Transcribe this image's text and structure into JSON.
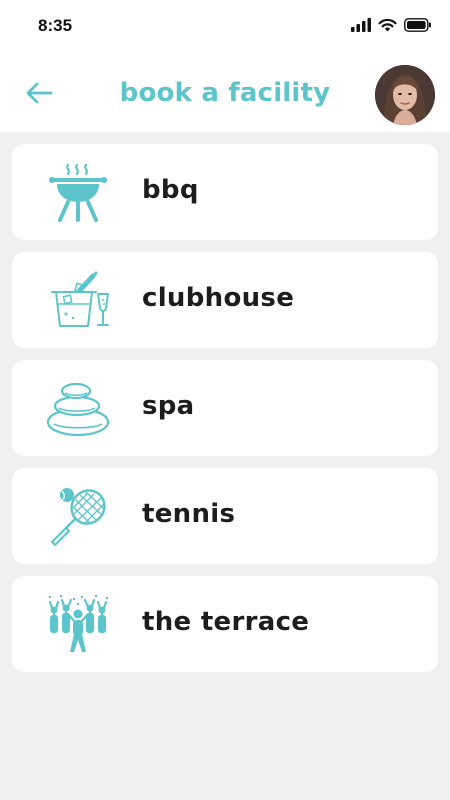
{
  "status_bar": {
    "time": "8:35",
    "icons": [
      "signal-icon",
      "wifi-icon",
      "battery-icon"
    ]
  },
  "header": {
    "title": "book a facility",
    "back_icon": "arrow-left-icon",
    "avatar": "user-avatar"
  },
  "colors": {
    "accent": "#5cc5cb",
    "background": "#f0f0f0",
    "card": "#ffffff",
    "text": "#1d1d1f"
  },
  "facilities": [
    {
      "label": "bbq",
      "icon": "bbq-grill-icon"
    },
    {
      "label": "clubhouse",
      "icon": "champagne-bucket-icon"
    },
    {
      "label": "spa",
      "icon": "spa-stones-icon"
    },
    {
      "label": "tennis",
      "icon": "tennis-racket-icon"
    },
    {
      "label": "the terrace",
      "icon": "party-crowd-icon"
    }
  ]
}
